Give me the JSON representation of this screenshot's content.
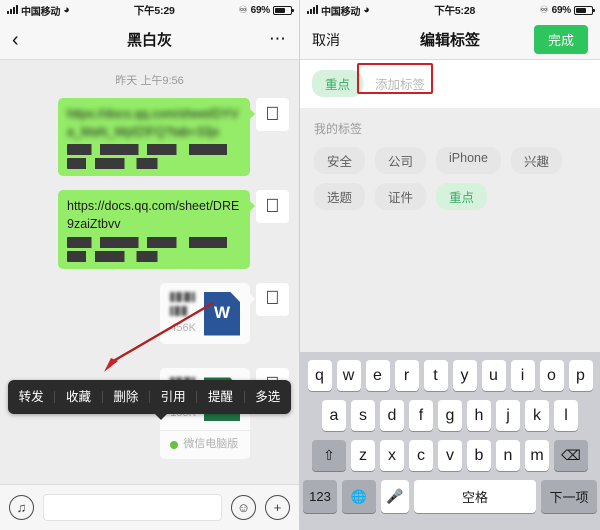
{
  "left": {
    "status": {
      "carrier": "中国移动",
      "time": "下午5:29",
      "battery": "69%",
      "wifi_icon": "wifi-icon",
      "headphone_icon": "headphone-icon"
    },
    "nav": {
      "back_icon": "back-chevron-icon",
      "title": "黑白灰",
      "more_icon": "more-dots-icon"
    },
    "chat": {
      "timestamp": "昨天 上午9:56",
      "messages": [
        {
          "type": "text",
          "text": "https://docs.qq.com/sheet/DYVa_MaN_WpfZIFQ?tab=33jx",
          "avatar_icon": "apple-avatar-icon"
        },
        {
          "type": "text",
          "text": "https://docs.qq.com/sheet/DRE9zaiZtbvv",
          "avatar_icon": "apple-avatar-icon"
        },
        {
          "type": "file",
          "filetype": "W",
          "size": "456K",
          "avatar_icon": "apple-avatar-icon"
        },
        {
          "type": "file",
          "filetype": "X",
          "size": "155K",
          "source": "微信电脑版",
          "avatar_icon": "apple-avatar-icon"
        }
      ]
    },
    "context_menu": [
      "转发",
      "收藏",
      "删除",
      "引用",
      "提醒",
      "多选"
    ],
    "input_bar": {
      "voice_icon": "voice-input-icon",
      "placeholder": "",
      "emoji_icon": "emoji-icon",
      "plus_icon": "plus-icon"
    }
  },
  "right": {
    "status": {
      "carrier": "中国移动",
      "time": "下午5:28",
      "battery": "69%"
    },
    "nav": {
      "cancel": "取消",
      "title": "编辑标签",
      "done": "完成"
    },
    "editor": {
      "selected_tags": [
        "重点"
      ],
      "add_placeholder": "添加标签",
      "mytags_label": "我的标签",
      "tags": [
        {
          "label": "安全",
          "selected": false
        },
        {
          "label": "公司",
          "selected": false
        },
        {
          "label": "iPhone",
          "selected": false
        },
        {
          "label": "兴趣",
          "selected": false
        },
        {
          "label": "选题",
          "selected": false
        },
        {
          "label": "证件",
          "selected": false
        },
        {
          "label": "重点",
          "selected": true
        }
      ]
    },
    "keyboard": {
      "row1": [
        "q",
        "w",
        "e",
        "r",
        "t",
        "y",
        "u",
        "i",
        "o",
        "p"
      ],
      "row2": [
        "a",
        "s",
        "d",
        "f",
        "g",
        "h",
        "j",
        "k",
        "l"
      ],
      "row3": [
        "z",
        "x",
        "c",
        "v",
        "b",
        "n",
        "m"
      ],
      "shift_icon": "shift-arrow-icon",
      "backspace_icon": "backspace-icon",
      "numeric": "123",
      "globe_icon": "globe-icon",
      "mic_icon": "microphone-icon",
      "space": "空格",
      "next": "下一项"
    }
  },
  "annotation": {
    "accent_color": "#cc2026",
    "arrow_icon": "red-arrow-icon",
    "box_icon": "red-highlight-box"
  },
  "colors": {
    "bubble_green": "#95ec69",
    "accent_green": "#2ec45e",
    "chat_bg": "#ededed"
  }
}
